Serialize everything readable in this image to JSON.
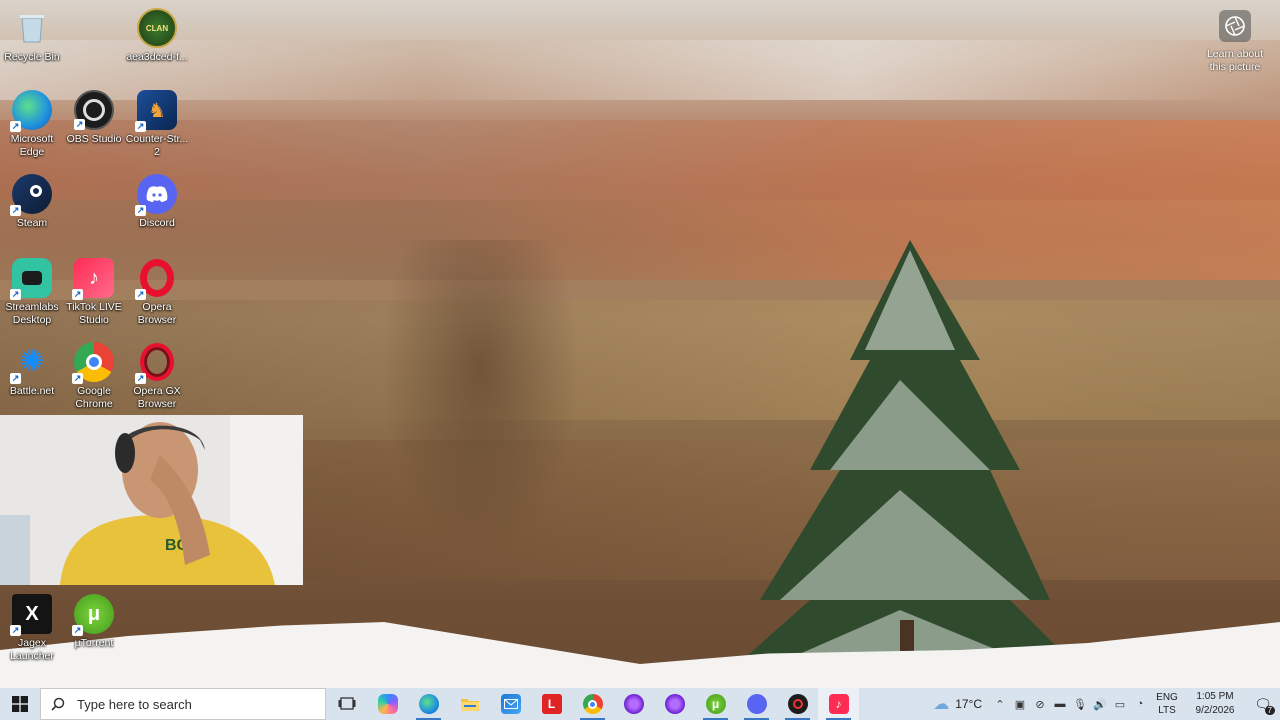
{
  "desktop": {
    "icons": [
      {
        "label": "Recycle Bin",
        "icon": "recycle-bin-icon"
      },
      {
        "label": "aea3dced-f...",
        "icon": "image-file-icon"
      },
      {
        "label": "Microsoft\nEdge",
        "icon": "edge-icon"
      },
      {
        "label": "OBS Studio",
        "icon": "obs-icon"
      },
      {
        "label": "Counter-Str...\n2",
        "icon": "counter-strike-icon"
      },
      {
        "label": "Steam",
        "icon": "steam-icon"
      },
      {
        "label": "Discord",
        "icon": "discord-icon"
      },
      {
        "label": "Streamlabs\nDesktop",
        "icon": "streamlabs-icon"
      },
      {
        "label": "TikTok LIVE\nStudio",
        "icon": "tiktok-live-icon"
      },
      {
        "label": "Opera\nBrowser",
        "icon": "opera-icon"
      },
      {
        "label": "Battle.net",
        "icon": "battlenet-icon"
      },
      {
        "label": "Google\nChrome",
        "icon": "chrome-icon"
      },
      {
        "label": "Opera GX\nBrowser",
        "icon": "opera-gx-icon"
      },
      {
        "label": "Jagex\nLauncher",
        "icon": "jagex-icon"
      },
      {
        "label": "µTorrent",
        "icon": "utorrent-icon"
      }
    ],
    "learn_about": "Learn about\nthis picture"
  },
  "taskbar": {
    "search_placeholder": "Type here to search",
    "pinned": [
      {
        "name": "task-view",
        "icon": "task-view-icon"
      },
      {
        "name": "copilot",
        "icon": "copilot-icon"
      },
      {
        "name": "edge",
        "icon": "edge-icon"
      },
      {
        "name": "file-explorer",
        "icon": "folder-icon"
      },
      {
        "name": "outlook",
        "icon": "mail-icon"
      },
      {
        "name": "l-app",
        "icon": "l-app-icon",
        "glyph": "L"
      },
      {
        "name": "chrome",
        "icon": "chrome-icon"
      },
      {
        "name": "purple-app-1",
        "icon": "purple-circle-icon"
      },
      {
        "name": "purple-app-2",
        "icon": "purple-circle-icon"
      },
      {
        "name": "utorrent",
        "icon": "utorrent-icon"
      },
      {
        "name": "discord-tray",
        "icon": "discord-icon"
      },
      {
        "name": "obs",
        "icon": "obs-icon"
      },
      {
        "name": "tiktok-live",
        "icon": "tiktok-icon"
      }
    ],
    "weather": "17°C",
    "lang_line1": "ENG",
    "lang_line2": "LTS",
    "time": "1:05 PM",
    "date": "9/2/2026",
    "notification_count": "7"
  }
}
